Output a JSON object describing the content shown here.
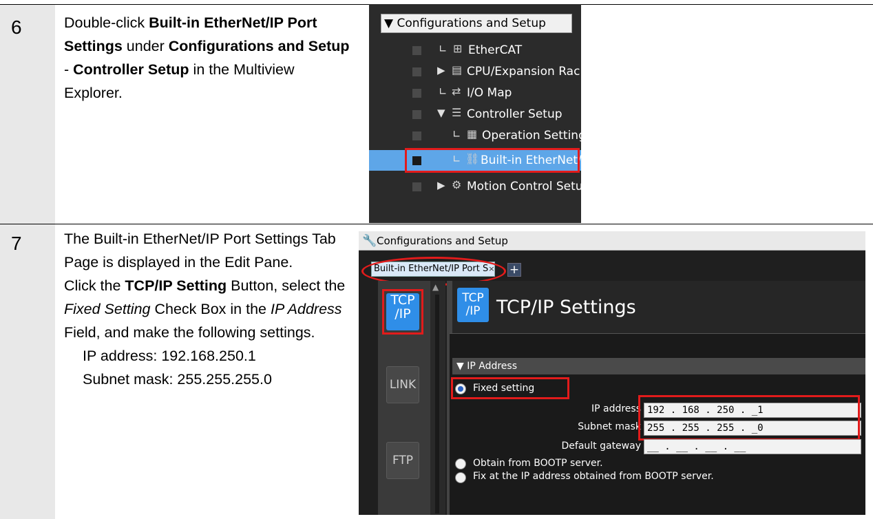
{
  "step6": {
    "number": "6",
    "desc": {
      "p1": "Double-click ",
      "b1": "Built-in EtherNet/IP Port Settings",
      "p2": " under ",
      "b2": "Configurations and Setup",
      "p3": " - ",
      "b3": "Controller Setup",
      "p4": " in the Multiview Explorer."
    },
    "tree": {
      "header": "Configurations and Setup",
      "header_glyph": "▼",
      "items": [
        {
          "glyph": "∟",
          "icon": "⊞",
          "icon_name": "ethercat-icon",
          "label": "EtherCAT"
        },
        {
          "glyph": "▶",
          "icon": "▤",
          "icon_name": "cpu-rack-icon",
          "label": "CPU/Expansion Racks"
        },
        {
          "glyph": "∟",
          "icon": "⇄",
          "icon_name": "io-map-icon",
          "label": "I/O Map"
        },
        {
          "glyph": "▼",
          "icon": "☰",
          "icon_name": "controller-setup-icon",
          "label": "Controller Setup"
        },
        {
          "glyph": "∟",
          "icon": "▦",
          "icon_name": "operation-settings-icon",
          "label": "Operation Settings"
        },
        {
          "glyph": "∟",
          "icon": "⛓",
          "icon_name": "ethernet-port-icon",
          "label": "Built-in EtherNet/IP Port Settings"
        },
        {
          "glyph": "▶",
          "icon": "⚙",
          "icon_name": "motion-control-icon",
          "label": "Motion Control Setup"
        }
      ],
      "selected_label": "Built-in EtherNet/IP Port Settings"
    }
  },
  "step7": {
    "number": "7",
    "desc": {
      "l1": "The Built-in EtherNet/IP Port Settings Tab Page is displayed in the Edit Pane.",
      "l2a": "Click the ",
      "l2b": "TCP/IP Setting",
      "l2c": " Button, select the ",
      "l2d": "Fixed Setting",
      "l2e": " Check Box in the ",
      "l2f": "IP Address",
      "l2g": " Field, and make the following settings.",
      "l3": "IP address: 192.168.250.1",
      "l4": "Subnet mask: 255.255.255.0"
    },
    "ui": {
      "window_title": "Configurations and Setup",
      "tab_label": "Built-in EtherNet/IP Port S",
      "tab_close": "×",
      "add_tab": "+",
      "side_buttons": [
        {
          "line1": "TCP",
          "line2": "/IP"
        },
        {
          "line1": "LINK",
          "line2": ""
        },
        {
          "line1": "FTP",
          "line2": ""
        }
      ],
      "header_icon": {
        "line1": "TCP",
        "line2": "/IP"
      },
      "header_title": "TCP/IP Settings",
      "section_title": "IP Address",
      "section_glyph": "▼",
      "fixed_setting": "Fixed setting",
      "ip_address_label": "IP address",
      "ip_address_value": "192 . 168 . 250 . _1",
      "subnet_mask_label": "Subnet mask",
      "subnet_mask_value": "255 . 255 . 255 . _0",
      "gateway_label": "Default gateway",
      "gateway_value": "__ . __ . __ . __",
      "bootp": "Obtain from BOOTP server.",
      "fix_bootp": "Fix at the IP address obtained from BOOTP server."
    },
    "highlight_color": "#e21b1b"
  }
}
